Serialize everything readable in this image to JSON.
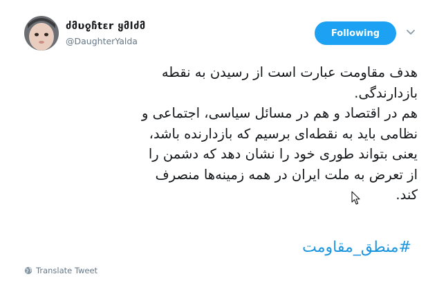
{
  "author": {
    "display_name": "ძმυჹჩtεr ყმlძმ",
    "handle": "@DaughterYalda"
  },
  "follow_button": {
    "label": "Following"
  },
  "tweet": {
    "lines": [
      "هدف مقاومت عبارت است از رسیدن به نقطه",
      "بازدارندگی.",
      "هم در اقتصاد و هم در مسائل سیاسی، اجتماعی و",
      "نظامی باید به نقطه‌ای برسیم که بازدارنده باشد،",
      "یعنی بتواند طوری خود را نشان دهد که دشمن را",
      "از تعرض به ملت ایران در همه زمینه‌ها منصرف",
      "کند."
    ],
    "hashtag": "#منطق_مقاومت"
  },
  "translate": {
    "label": "Translate Tweet"
  },
  "icons": {
    "caret": "chevron-down-icon",
    "globe": "globe-icon",
    "cursor": "mouse-pointer-icon"
  },
  "colors": {
    "accent": "#1da1f2",
    "hashtag": "#1b95e0",
    "text": "#14171a",
    "muted": "#657786"
  }
}
